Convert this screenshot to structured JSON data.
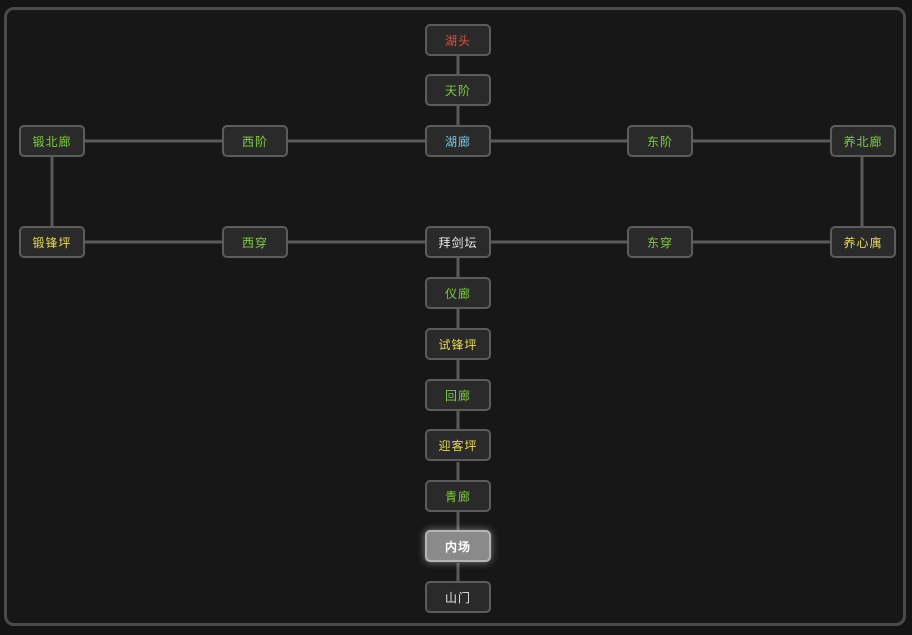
{
  "colors": {
    "red": "#e0513a",
    "green": "#7ccd3a",
    "cyan": "#7fc7e3",
    "yellow": "#e6d84a",
    "white": "#e6e6e6"
  },
  "rooms": {
    "hutou": {
      "label": "湖头",
      "color": "#e0513a"
    },
    "tianjie": {
      "label": "天阶",
      "color": "#7ccd3a"
    },
    "duanbeilang": {
      "label": "锻北廊",
      "color": "#7ccd3a"
    },
    "xijie": {
      "label": "西阶",
      "color": "#7ccd3a"
    },
    "hulang": {
      "label": "湖廊",
      "color": "#7fc7e3"
    },
    "dongjie": {
      "label": "东阶",
      "color": "#7ccd3a"
    },
    "yangbeilang": {
      "label": "养北廊",
      "color": "#7ccd3a"
    },
    "duanfengping": {
      "label": "锻锋坪",
      "color": "#e6d84a"
    },
    "xichuan": {
      "label": "西穿",
      "color": "#7ccd3a"
    },
    "baijiantan": {
      "label": "拜剑坛",
      "color": "#e6e6e6"
    },
    "dongchuan": {
      "label": "东穿",
      "color": "#7ccd3a"
    },
    "yangxinyu": {
      "label": "养心庽",
      "color": "#e6d84a"
    },
    "yilang": {
      "label": "仪廊",
      "color": "#7ccd3a"
    },
    "shifengping": {
      "label": "试锋坪",
      "color": "#e6d84a"
    },
    "huilang": {
      "label": "回廊",
      "color": "#7ccd3a"
    },
    "yingkeping": {
      "label": "迎客坪",
      "color": "#e6d84a"
    },
    "qinglang": {
      "label": "青廊",
      "color": "#7ccd3a"
    },
    "neichang": {
      "label": "内场",
      "color": "#ffffff",
      "current": true
    },
    "shanmen": {
      "label": "山门",
      "color": "#e6e6e6"
    }
  }
}
